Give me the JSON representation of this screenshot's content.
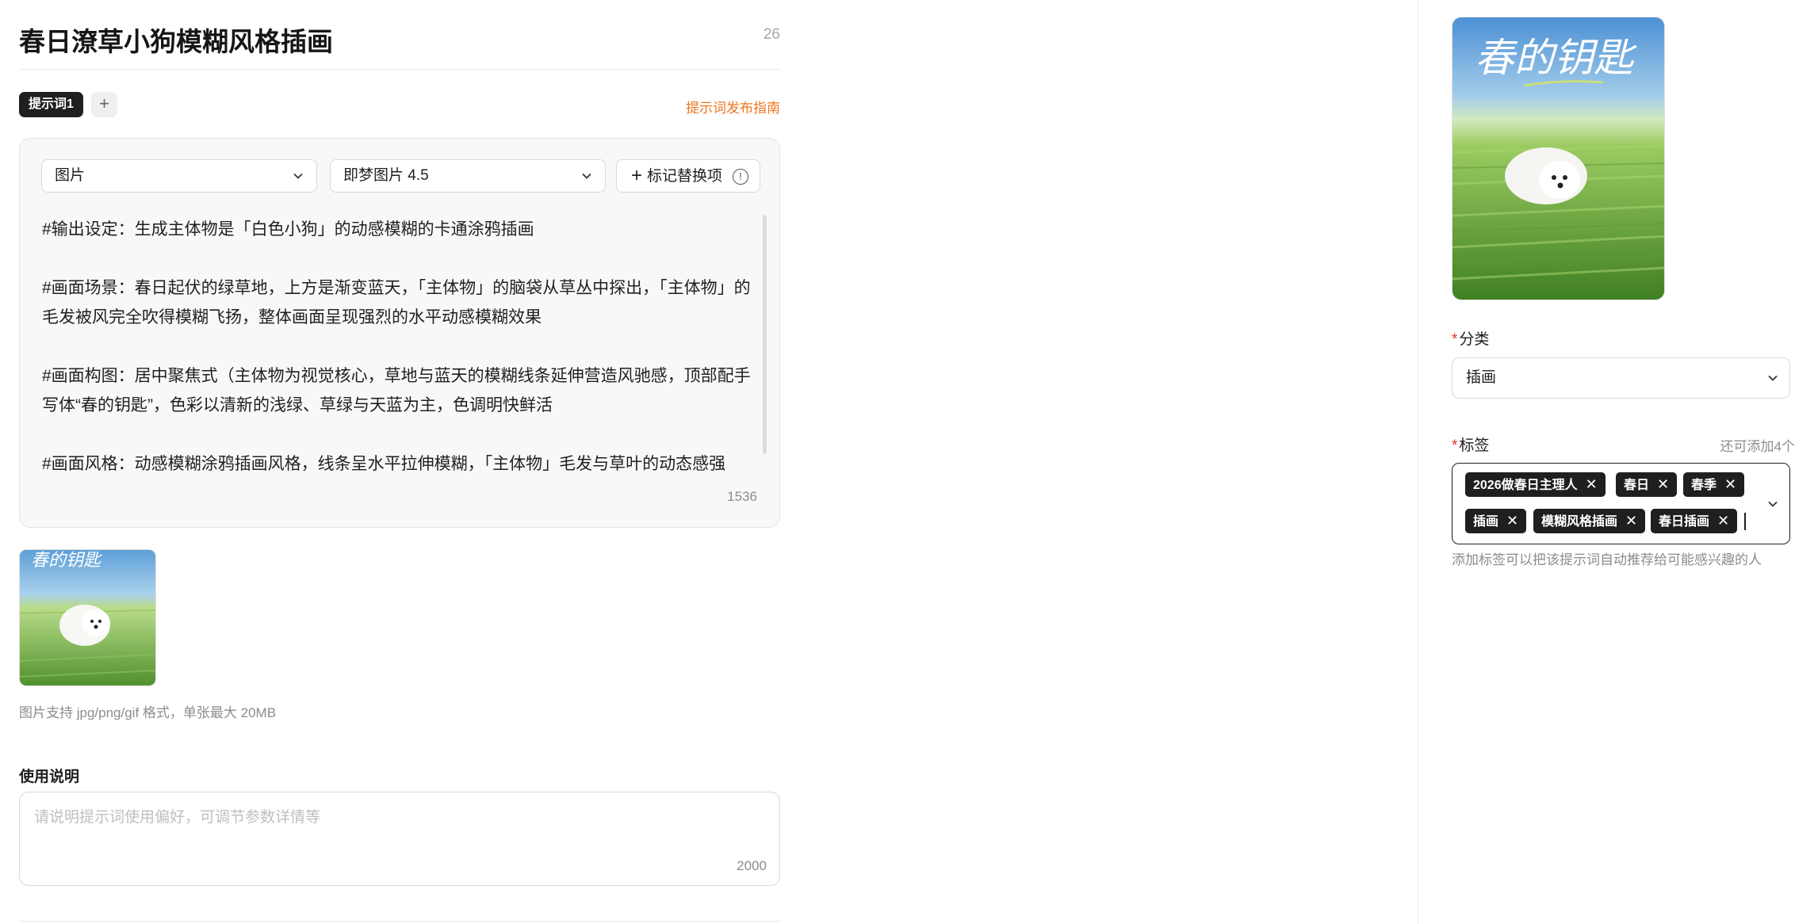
{
  "page": {
    "title": "春日潦草小狗模糊风格插画",
    "title_count": "26"
  },
  "tabs": {
    "active_label": "提示词1",
    "add_label": "+",
    "guide_link": "提示词发布指南"
  },
  "editor": {
    "type_select": "图片",
    "model_select": "即梦图片 4.5",
    "mark_button": "标记替换项",
    "prompt_text": "#输出设定：生成主体物是「白色小狗」的动感模糊的卡通涂鸦插画\n\n#画面场景：春日起伏的绿草地，上方是渐变蓝天，「主体物」的脑袋从草丛中探出，「主体物」的毛发被风完全吹得模糊飞扬，整体画面呈现强烈的水平动感模糊效果\n\n#画面构图：居中聚焦式（主体物为视觉核心，草地与蓝天的模糊线条延伸营造风驰感，顶部配手写体“春的钥匙”，色彩以清新的浅绿、草绿与天蓝为主，色调明快鲜活\n\n#画面风格：动感模糊涂鸦插画风格，线条呈水平拉伸模糊，「主体物」毛发与草叶的动态感强",
    "prompt_count": "1536"
  },
  "upload": {
    "note": "图片支持 jpg/png/gif 格式，单张最大 20MB",
    "thumb_title": "春的钥匙"
  },
  "usage": {
    "label": "使用说明",
    "placeholder": "请说明提示词使用偏好，可调节参数详情等",
    "count": "2000"
  },
  "sidebar": {
    "cover_title": "春的钥匙",
    "category_label": "分类",
    "category_value": "插画",
    "tags_label": "标签",
    "tags_remaining": "还可添加4个",
    "tags": [
      "2026做春日主理人",
      "春日",
      "春季",
      "插画",
      "模糊风格插画",
      "春日插画"
    ],
    "tags_hint": "添加标签可以把该提示词自动推荐给可能感兴趣的人"
  },
  "colors": {
    "accent": "#f2741c",
    "required": "#e5322e",
    "tag_bg": "#1f1f1f"
  },
  "icons": [
    "chevron-down-icon",
    "plus-icon",
    "info-icon",
    "close-icon"
  ]
}
